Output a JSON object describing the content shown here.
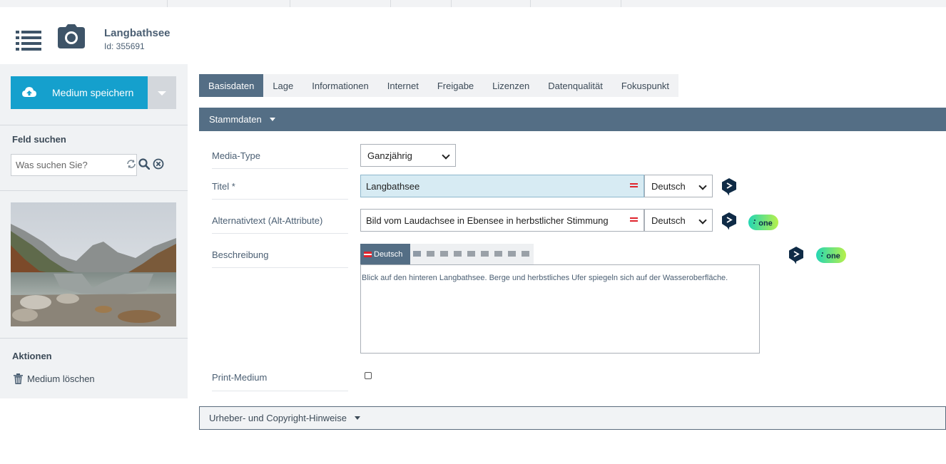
{
  "header": {
    "title": "Langbathsee",
    "id_text": "Id: 355691"
  },
  "sidebar": {
    "save_label": "Medium speichern",
    "search_heading": "Feld suchen",
    "search_placeholder": "Was suchen Sie?",
    "actions_heading": "Aktionen",
    "delete_label": "Medium löschen"
  },
  "tabs": [
    {
      "label": "Basisdaten",
      "active": true
    },
    {
      "label": "Lage"
    },
    {
      "label": "Informationen"
    },
    {
      "label": "Internet"
    },
    {
      "label": "Freigabe"
    },
    {
      "label": "Lizenzen"
    },
    {
      "label": "Datenqualität"
    },
    {
      "label": "Fokuspunkt"
    }
  ],
  "sections": {
    "stammdaten": "Stammdaten",
    "copyright": "Urheber- und Copyright-Hinweise"
  },
  "form": {
    "media_type_label": "Media-Type",
    "media_type_value": "Ganzjährig",
    "title_label": "Titel *",
    "title_value": "Langbathsee",
    "title_lang": "Deutsch",
    "alt_label": "Alternativtext (Alt-Attribute)",
    "alt_value": "Bild vom Laudachsee in Ebensee in herbstlicher Stimmung",
    "alt_lang": "Deutsch",
    "desc_label": "Beschreibung",
    "desc_lang_tab": "Deutsch",
    "desc_text": "Blick auf den hinteren Langbathsee. Berge und herbstliches Ufer spiegeln sich auf der Wasseroberfläche.",
    "print_label": "Print-Medium",
    "print_checked": false
  },
  "badges": {
    "one_text": "one"
  },
  "colors": {
    "primary_button": "#15a0cd",
    "section_bar": "#546e85",
    "sidebar_bg": "#f0f2f4",
    "flag_red": "#e0242d"
  }
}
